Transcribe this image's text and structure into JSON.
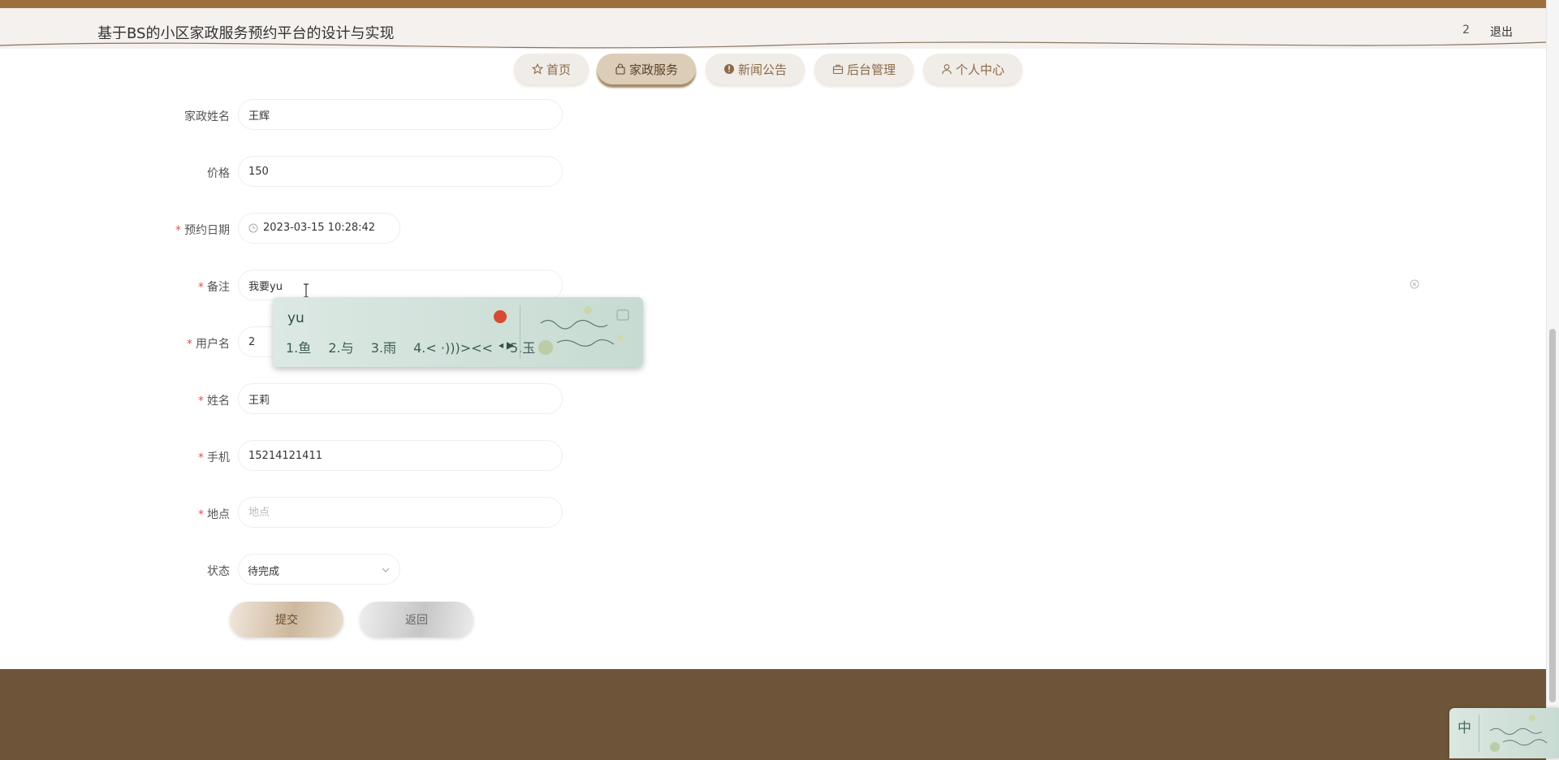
{
  "app": {
    "title": "基于BS的小区家政服务预约平台的设计与实现",
    "user": "2",
    "logout": "退出"
  },
  "nav": [
    {
      "label": "首页",
      "icon": "star-icon"
    },
    {
      "label": "家政服务",
      "icon": "bag-icon",
      "active": true
    },
    {
      "label": "新闻公告",
      "icon": "alert-icon"
    },
    {
      "label": "后台管理",
      "icon": "briefcase-icon"
    },
    {
      "label": "个人中心",
      "icon": "user-icon"
    }
  ],
  "form": {
    "name_label": "家政姓名",
    "name_value": "王辉",
    "price_label": "价格",
    "price_value": "150",
    "date_label": "预约日期",
    "date_value": "2023-03-15 10:28:42",
    "note_label": "备注",
    "note_value": "我要yu",
    "username_label": "用户名",
    "username_value": "2",
    "realname_label": "姓名",
    "realname_value": "王莉",
    "phone_label": "手机",
    "phone_value": "15214121411",
    "location_label": "地点",
    "location_placeholder": "地点",
    "status_label": "状态",
    "status_value": "待完成",
    "required_mark": "*",
    "submit": "提交",
    "back": "返回"
  },
  "ime": {
    "pinyin": "yu",
    "candidates": [
      "1.鱼",
      "2.与",
      "3.雨",
      "4.< ·)))><<",
      "5.玉"
    ],
    "tray_mode": "中"
  },
  "colors": {
    "header_strip": "#9c6f3c",
    "footer": "#6e5539",
    "nav_text": "#8a6a48",
    "required": "#e35050"
  }
}
